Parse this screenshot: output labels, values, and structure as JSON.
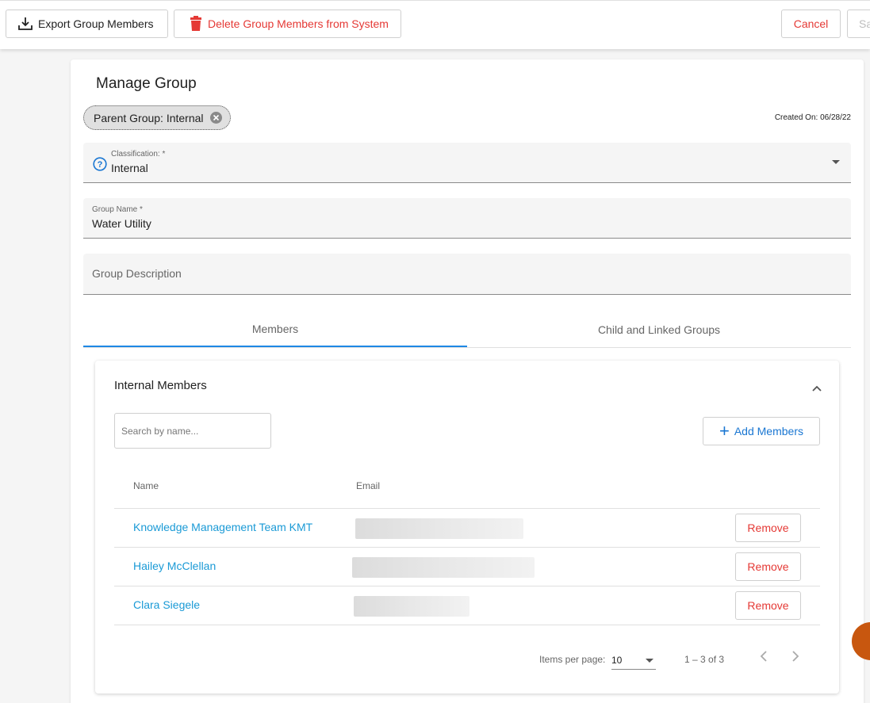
{
  "toolbar": {
    "export_label": "Export Group Members",
    "delete_label": "Delete Group Members from System",
    "cancel_label": "Cancel",
    "save_label": "Sa"
  },
  "page": {
    "title": "Manage Group",
    "parent_chip": "Parent Group: Internal",
    "created_on": "Created On: 06/28/22"
  },
  "form": {
    "classification_label": "Classification: *",
    "classification_value": "Internal",
    "group_name_label": "Group Name *",
    "group_name_value": "Water Utility",
    "description_placeholder": "Group Description"
  },
  "tabs": [
    {
      "label": "Members",
      "active": true
    },
    {
      "label": "Child and Linked Groups",
      "active": false
    }
  ],
  "members_panel": {
    "title": "Internal Members",
    "search_placeholder": "Search by name...",
    "add_label": "Add Members",
    "columns": {
      "name": "Name",
      "email": "Email"
    },
    "rows": [
      {
        "name": "Knowledge Management Team KMT",
        "action": "Remove"
      },
      {
        "name": "Hailey McClellan",
        "action": "Remove"
      },
      {
        "name": "Clara Siegele",
        "action": "Remove"
      }
    ],
    "pager": {
      "items_per_page_label": "Items per page:",
      "items_per_page": "10",
      "range": "1 – 3 of 3"
    }
  },
  "colors": {
    "accent": "#1e88e5",
    "link": "#1a9ad6",
    "danger": "#e53935",
    "fab": "#c8570f"
  }
}
